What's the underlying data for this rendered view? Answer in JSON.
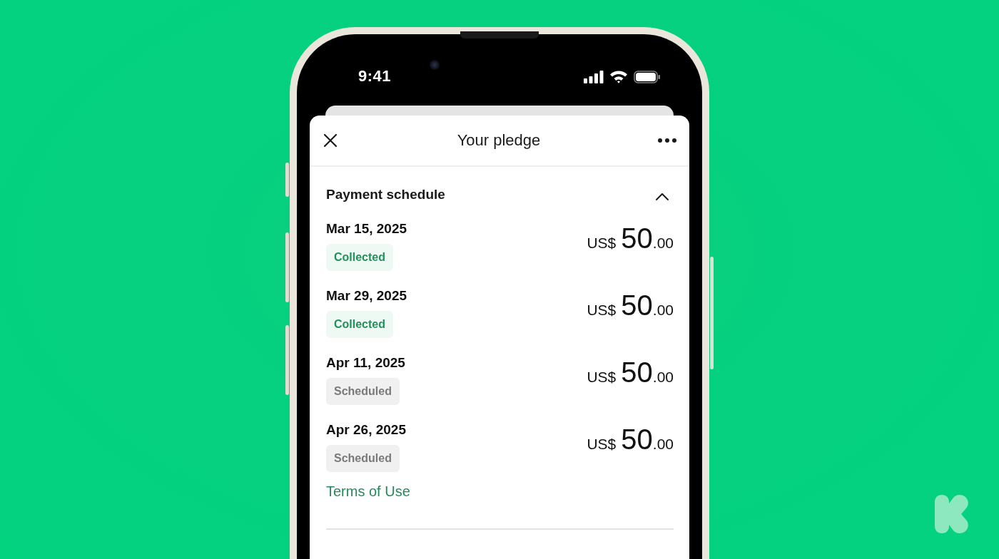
{
  "status_bar": {
    "time": "9:41"
  },
  "sheet": {
    "title": "Your pledge"
  },
  "section": {
    "title": "Payment schedule",
    "expanded": true
  },
  "payments": [
    {
      "date": "Mar 15, 2025",
      "status": {
        "label": "Collected",
        "kind": "collected"
      },
      "currency": "US$",
      "whole": "50",
      "cents": ".00"
    },
    {
      "date": "Mar 29, 2025",
      "status": {
        "label": "Collected",
        "kind": "collected"
      },
      "currency": "US$",
      "whole": "50",
      "cents": ".00"
    },
    {
      "date": "Apr 11, 2025",
      "status": {
        "label": "Scheduled",
        "kind": "scheduled"
      },
      "currency": "US$",
      "whole": "50",
      "cents": ".00"
    },
    {
      "date": "Apr 26, 2025",
      "status": {
        "label": "Scheduled",
        "kind": "scheduled"
      },
      "currency": "US$",
      "whole": "50",
      "cents": ".00"
    }
  ],
  "terms_link": "Terms of Use"
}
